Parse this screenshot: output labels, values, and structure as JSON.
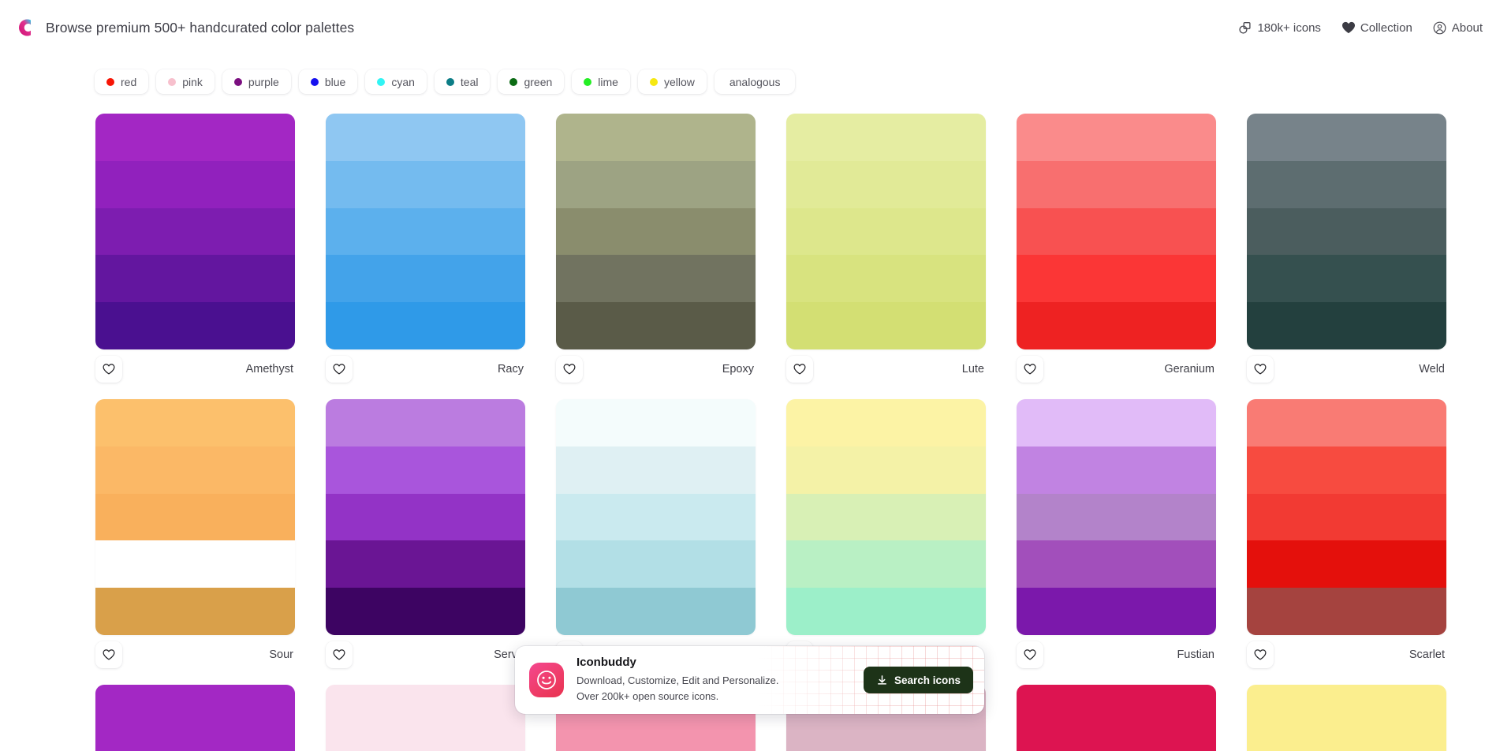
{
  "header": {
    "logo_icon": "colorsinspo-c-logo-icon",
    "title": "Browse premium 500+ handcurated color palettes",
    "nav": [
      {
        "label": "180k+ icons",
        "icon": "shapes-icon"
      },
      {
        "label": "Collection",
        "icon": "heart-filled-icon"
      },
      {
        "label": "About",
        "icon": "user-circle-icon"
      }
    ]
  },
  "filters": [
    {
      "label": "red",
      "color": "#f71505"
    },
    {
      "label": "pink",
      "color": "#f7c0cd"
    },
    {
      "label": "purple",
      "color": "#7b0f80"
    },
    {
      "label": "blue",
      "color": "#1610ef"
    },
    {
      "label": "cyan",
      "color": "#31f4f4"
    },
    {
      "label": "teal",
      "color": "#0c7d86"
    },
    {
      "label": "green",
      "color": "#0b6b14"
    },
    {
      "label": "lime",
      "color": "#24ee24"
    },
    {
      "label": "yellow",
      "color": "#f6e812"
    },
    {
      "label": "analogous",
      "color": null
    }
  ],
  "palettes": [
    {
      "name": "Amethyst",
      "fav_icon": "heart-outline-icon",
      "colors": [
        "#a327c4",
        "#9121bd",
        "#7d1db0",
        "#63169f",
        "#4a1090"
      ]
    },
    {
      "name": "Racy",
      "fav_icon": "heart-outline-icon",
      "colors": [
        "#8fc7f2",
        "#74bbef",
        "#5cb0ed",
        "#43a3ea",
        "#2f9ae8"
      ]
    },
    {
      "name": "Epoxy",
      "fav_icon": "heart-outline-icon",
      "colors": [
        "#afb48c",
        "#9da383",
        "#8a8d6d",
        "#717360",
        "#5a5b48"
      ]
    },
    {
      "name": "Lute",
      "fav_icon": "heart-outline-icon",
      "colors": [
        "#e5eda2",
        "#e1ea97",
        "#dde78c",
        "#d8e37f",
        "#d3df73"
      ]
    },
    {
      "name": "Geranium",
      "fav_icon": "heart-outline-icon",
      "colors": [
        "#fa8b8b",
        "#f86f6f",
        "#f85151",
        "#fb3636",
        "#ee2222"
      ]
    },
    {
      "name": "Weld",
      "fav_icon": "heart-outline-icon",
      "colors": [
        "#77838a",
        "#5d6d70",
        "#4b5d5e",
        "#35504f",
        "#23403e"
      ]
    },
    {
      "name": "Sour",
      "fav_icon": "heart-outline-icon",
      "colors": [
        "#fcc06c",
        "#fbb866",
        "#f9b05c",
        "#ecا9f52",
        "#d9a04a"
      ]
    },
    {
      "name": "Serve",
      "fav_icon": "heart-outline-icon",
      "colors": [
        "#bb7ce0",
        "#a955dc",
        "#9333c6",
        "#6a1594",
        "#3d0462"
      ]
    },
    {
      "name": "",
      "fav_icon": "heart-outline-icon",
      "colors": [
        "#f4fcfc",
        "#dff0f3",
        "#caeaef",
        "#b2dfe6",
        "#8fc9d3"
      ]
    },
    {
      "name": "",
      "fav_icon": "heart-outline-icon",
      "colors": [
        "#fcf3a5",
        "#f4f2a7",
        "#d8f0b5",
        "#b9f0c4",
        "#9cefc9"
      ]
    },
    {
      "name": "Fustian",
      "fav_icon": "heart-outline-icon",
      "colors": [
        "#e1bbf8",
        "#c183e2",
        "#b383ca",
        "#a24fbb",
        "#7b18ab"
      ]
    },
    {
      "name": "Scarlet",
      "fav_icon": "heart-outline-icon",
      "colors": [
        "#f97b74",
        "#f74b40",
        "#f23a33",
        "#e4100c",
        "#a5433f"
      ]
    },
    {
      "name": "",
      "fav_icon": "heart-outline-icon",
      "colors": [
        "#a328c4"
      ]
    },
    {
      "name": "",
      "fav_icon": "heart-outline-icon",
      "colors": [
        "#fae4ed"
      ]
    },
    {
      "name": "",
      "fav_icon": "heart-outline-icon",
      "colors": [
        "#f394ae"
      ]
    },
    {
      "name": "",
      "fav_icon": "heart-outline-icon",
      "colors": [
        "#dbb4c4"
      ]
    },
    {
      "name": "",
      "fav_icon": "heart-outline-icon",
      "colors": [
        "#dd1451"
      ]
    },
    {
      "name": "",
      "fav_icon": "heart-outline-icon",
      "colors": [
        "#fbee8e"
      ]
    }
  ],
  "promo": {
    "icon": "smiley-face-icon",
    "title": "Iconbuddy",
    "subtitle": "Download, Customize, Edit and Personalize. Over 200k+ open source icons.",
    "button_label": "Search icons",
    "button_icon": "download-icon",
    "button_color": "#1d3318"
  }
}
